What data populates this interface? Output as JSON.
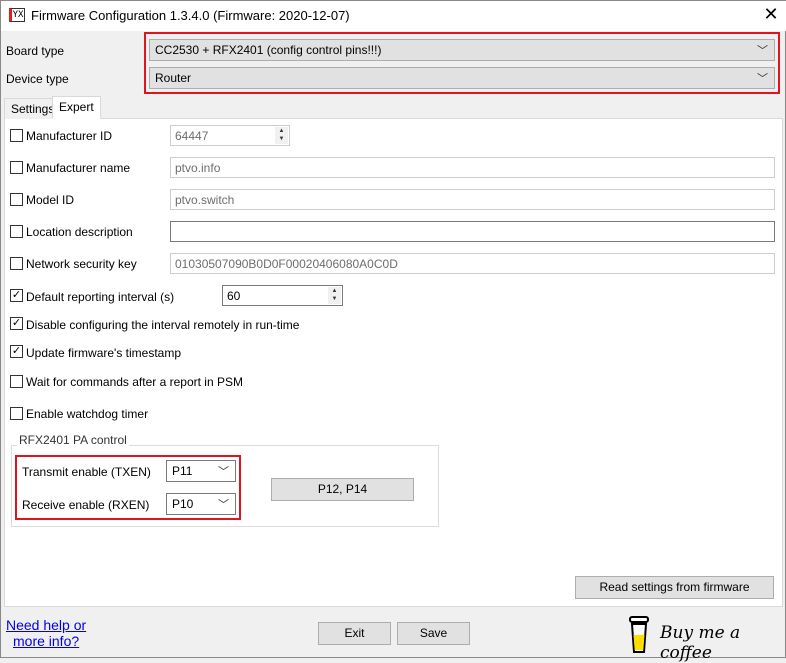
{
  "window": {
    "title": "Firmware Configuration 1.3.4.0 (Firmware: 2020-12-07)",
    "icon": "app-icon",
    "icon_text": "YX"
  },
  "board_type": {
    "label": "Board type",
    "value": "CC2530 + RFX2401 (config control pins!!!)"
  },
  "device_type": {
    "label": "Device type",
    "value": "Router"
  },
  "tabs": [
    {
      "label": "Settings",
      "active": false
    },
    {
      "label": "Expert",
      "active": true
    }
  ],
  "fields": {
    "manufacturer_id": {
      "label": "Manufacturer ID",
      "checked": false,
      "value": "64447"
    },
    "manufacturer_name": {
      "label": "Manufacturer name",
      "checked": false,
      "value": "ptvo.info"
    },
    "model_id": {
      "label": "Model ID",
      "checked": false,
      "value": "ptvo.switch"
    },
    "location": {
      "label": "Location description",
      "checked": false,
      "value": ""
    },
    "network_key": {
      "label": "Network security key",
      "checked": false,
      "value": "01030507090B0D0F00020406080A0C0D"
    },
    "reporting_interval": {
      "label": "Default reporting interval (s)",
      "checked": true,
      "value": "60"
    }
  },
  "options": [
    {
      "label": "Disable configuring the interval remotely in run-time",
      "checked": true
    },
    {
      "label": "Update firmware's timestamp",
      "checked": true
    },
    {
      "label": "Wait for commands after a report in PSM",
      "checked": false
    },
    {
      "label": "Enable watchdog timer",
      "checked": false
    }
  ],
  "pa_control": {
    "legend": "RFX2401 PA control",
    "txen_label": "Transmit enable (TXEN)",
    "txen": "P11",
    "rxen_label": "Receive enable (RXEN)",
    "rxen": "P10",
    "pins_button": "P12, P14"
  },
  "buttons": {
    "read": "Read settings from firmware",
    "exit": "Exit",
    "save": "Save"
  },
  "help_link": {
    "line1": "Need help or",
    "line2": "more info?"
  },
  "coffee": {
    "text": "Buy me a coffee"
  },
  "colors": {
    "highlight": "#e0141e",
    "link": "#0000ee",
    "coffee_yellow": "#ffdd00"
  }
}
